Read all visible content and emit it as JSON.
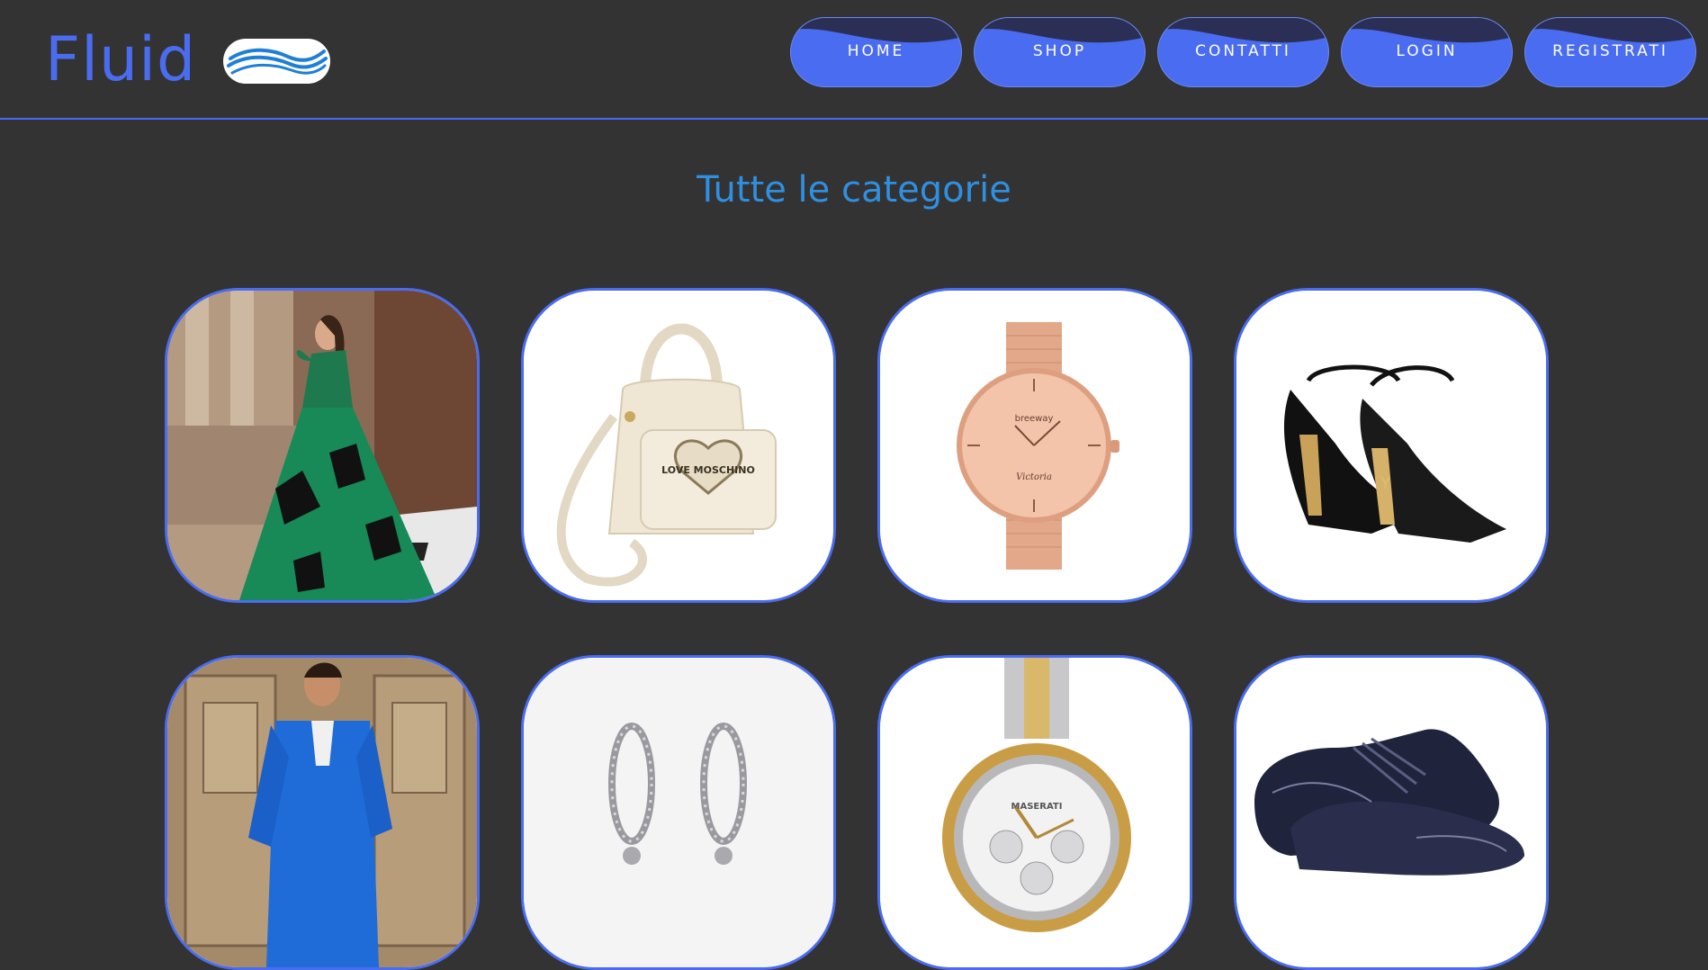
{
  "header": {
    "brand": "Fluid",
    "logo_icon": "waves-logo-icon",
    "nav": [
      {
        "label": "HOME"
      },
      {
        "label": "SHOP"
      },
      {
        "label": "CONTATTI"
      },
      {
        "label": "LOGIN"
      },
      {
        "label": "REGISTRATI"
      }
    ]
  },
  "main": {
    "title": "Tutte le categorie",
    "categories": [
      {
        "name": "abiti-donna",
        "image": "woman-green-dress-image"
      },
      {
        "name": "borse",
        "image": "handbag-image"
      },
      {
        "name": "orologi-donna",
        "image": "rose-gold-watch-image"
      },
      {
        "name": "scarpe-donna",
        "image": "high-heel-sandal-image"
      },
      {
        "name": "abiti-uomo",
        "image": "man-blue-suit-image"
      },
      {
        "name": "gioielli",
        "image": "hoop-earrings-image"
      },
      {
        "name": "orologi-uomo",
        "image": "steel-gold-watch-image"
      },
      {
        "name": "scarpe-uomo",
        "image": "patent-leather-shoes-image"
      }
    ],
    "image_text": {
      "handbag": "LOVE MOSCHINO",
      "watch_brand": "breeway",
      "watch_model": "Victoria",
      "maserati": "MASERATI"
    }
  },
  "colors": {
    "background": "#333333",
    "accent": "#4a6cf0",
    "title": "#2f8fe0",
    "card_bg": "#ffffff"
  }
}
